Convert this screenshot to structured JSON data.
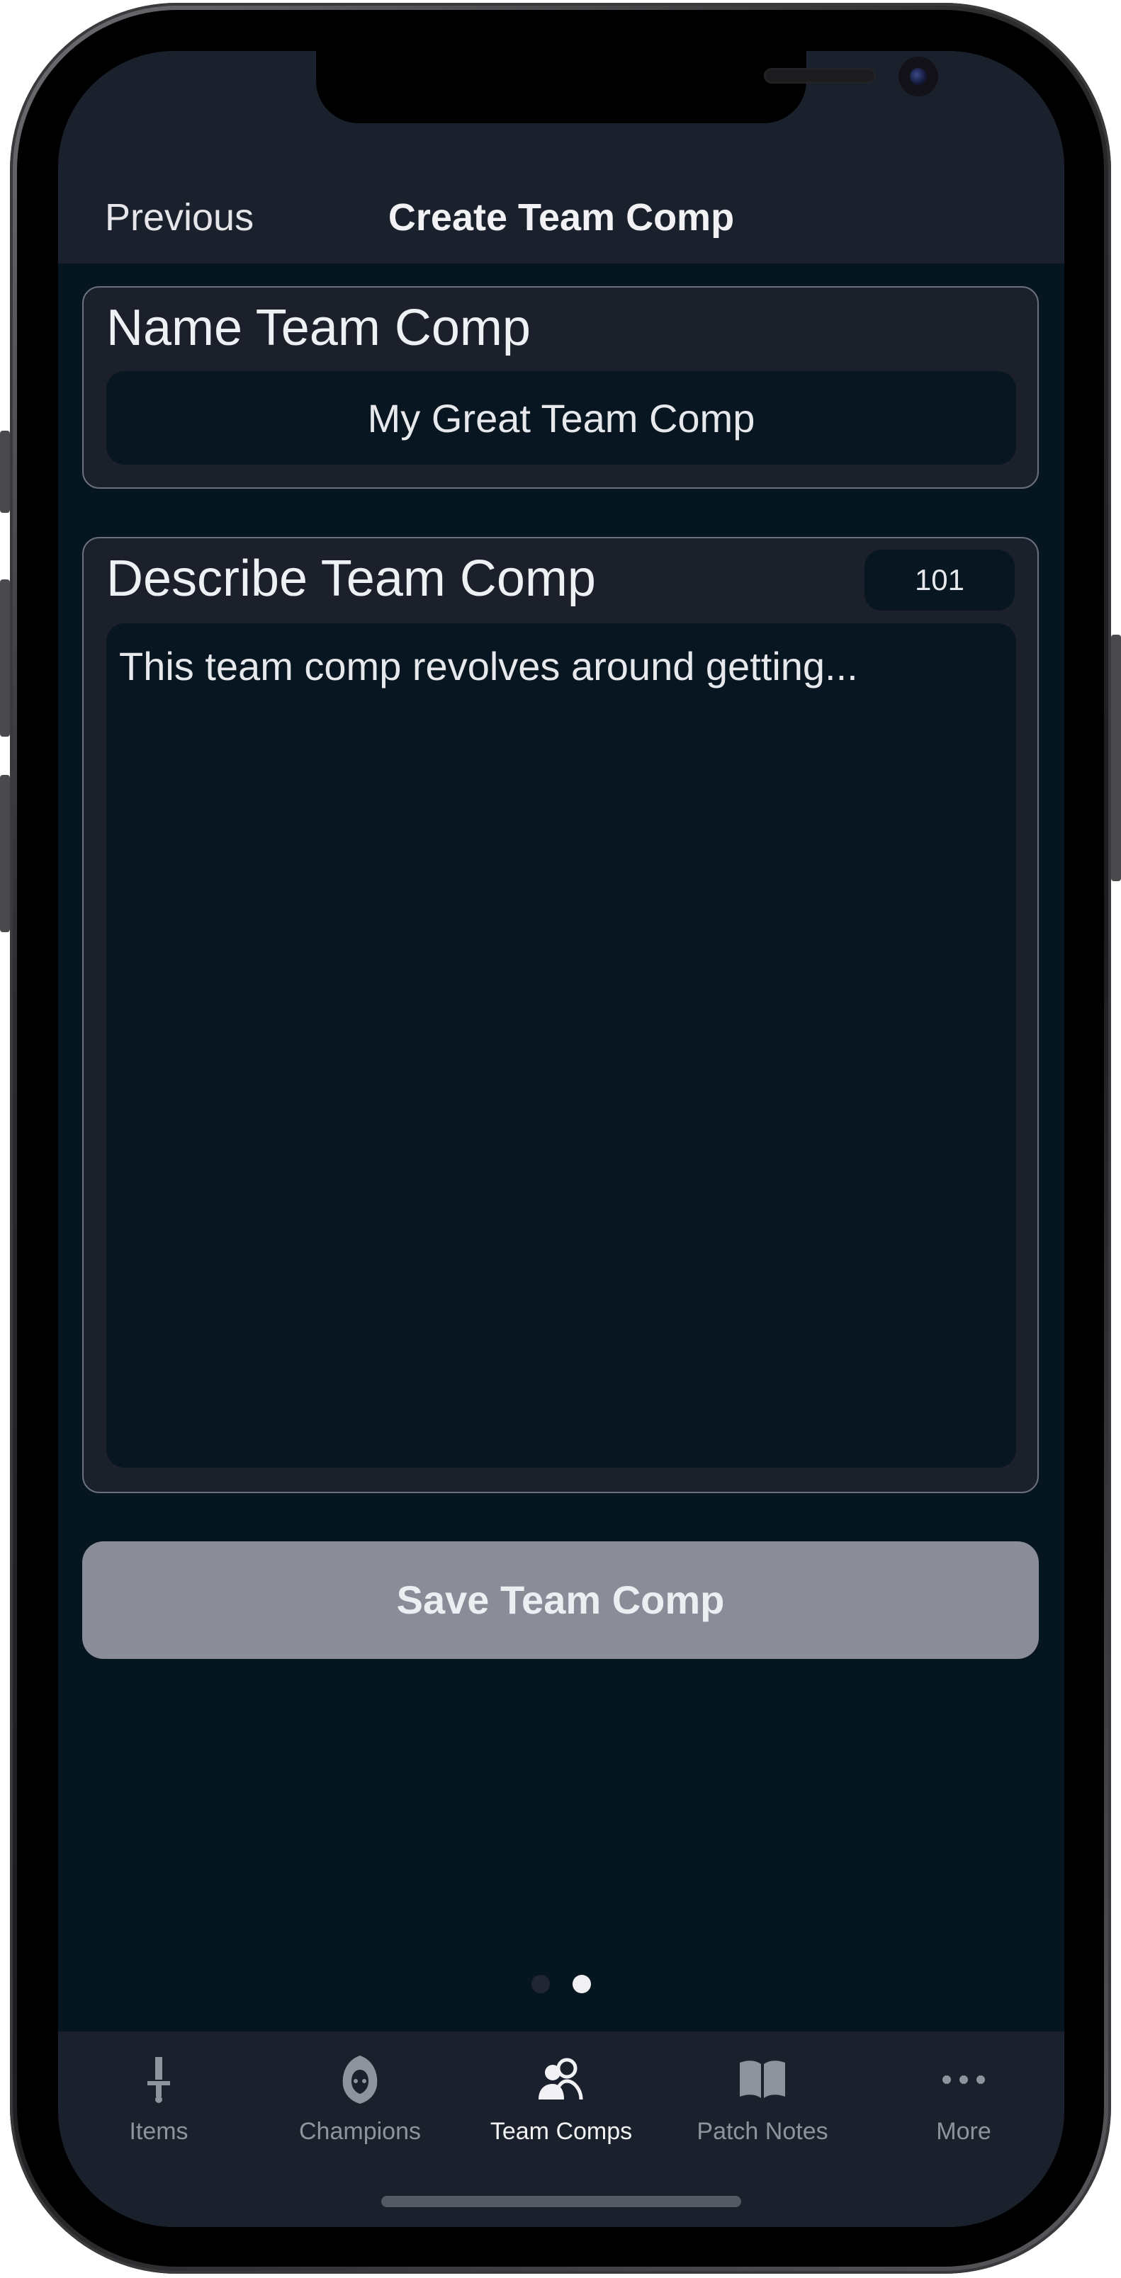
{
  "header": {
    "back_label": "Previous",
    "title": "Create Team Comp"
  },
  "name_card": {
    "title": "Name Team Comp",
    "value": "My Great Team Comp"
  },
  "description_card": {
    "title": "Describe Team Comp",
    "char_count": "101",
    "value": "This team comp revolves around getting..."
  },
  "save_button": {
    "label": "Save Team Comp"
  },
  "pager": {
    "pages": 2,
    "current": 2
  },
  "tab_bar": {
    "items": [
      {
        "label": "Items",
        "icon": "sword-icon",
        "active": false
      },
      {
        "label": "Champions",
        "icon": "hooded-figure-icon",
        "active": false
      },
      {
        "label": "Team Comps",
        "icon": "team-people-icon",
        "active": true
      },
      {
        "label": "Patch Notes",
        "icon": "book-icon",
        "active": false
      },
      {
        "label": "More",
        "icon": "ellipsis-icon",
        "active": false
      }
    ]
  },
  "colors": {
    "background": "#061620",
    "bar_background": "#1b212c",
    "card_background": "#1c202b",
    "save_button": "#8a8c98",
    "tab_inactive": "#8e939e",
    "tab_active": "#f2f2f5"
  }
}
